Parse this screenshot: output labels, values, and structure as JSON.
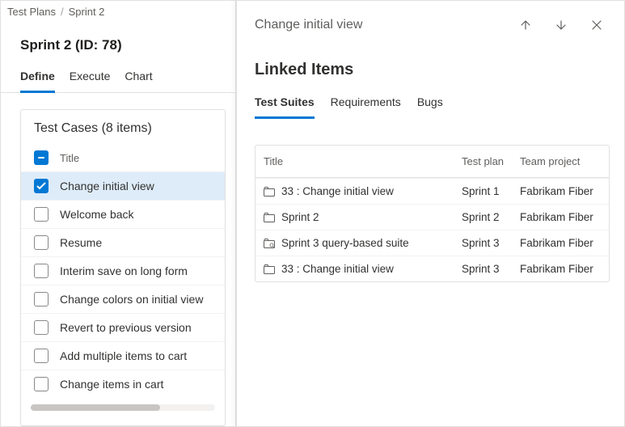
{
  "breadcrumb": {
    "root": "Test Plans",
    "current": "Sprint 2"
  },
  "page_title": "Sprint 2 (ID: 78)",
  "view_tabs": [
    {
      "label": "Define",
      "selected": true
    },
    {
      "label": "Execute",
      "selected": false
    },
    {
      "label": "Chart",
      "selected": false
    }
  ],
  "card_title": "Test Cases (8 items)",
  "list_header": {
    "title_col": "Title"
  },
  "test_cases": [
    {
      "title": "Change initial view",
      "checked": true
    },
    {
      "title": "Welcome back",
      "checked": false
    },
    {
      "title": "Resume",
      "checked": false
    },
    {
      "title": "Interim save on long form",
      "checked": false
    },
    {
      "title": "Change colors on initial view",
      "checked": false
    },
    {
      "title": "Revert to previous version",
      "checked": false
    },
    {
      "title": "Add multiple items to cart",
      "checked": false
    },
    {
      "title": "Change items in cart",
      "checked": false
    }
  ],
  "panel": {
    "header_title": "Change initial view",
    "section_title": "Linked Items",
    "tabs": [
      {
        "label": "Test Suites",
        "selected": true
      },
      {
        "label": "Requirements",
        "selected": false
      },
      {
        "label": "Bugs",
        "selected": false
      }
    ],
    "columns": {
      "title": "Title",
      "plan": "Test plan",
      "team": "Team project"
    },
    "rows": [
      {
        "icon": "suite",
        "title": "33 : Change initial view",
        "plan": "Sprint 1",
        "team": "Fabrikam Fiber"
      },
      {
        "icon": "suite",
        "title": "Sprint 2",
        "plan": "Sprint 2",
        "team": "Fabrikam Fiber"
      },
      {
        "icon": "query-suite",
        "title": "Sprint 3 query-based suite",
        "plan": "Sprint 3",
        "team": "Fabrikam Fiber"
      },
      {
        "icon": "suite",
        "title": "33 : Change initial view",
        "plan": "Sprint 3",
        "team": "Fabrikam Fiber"
      }
    ]
  }
}
